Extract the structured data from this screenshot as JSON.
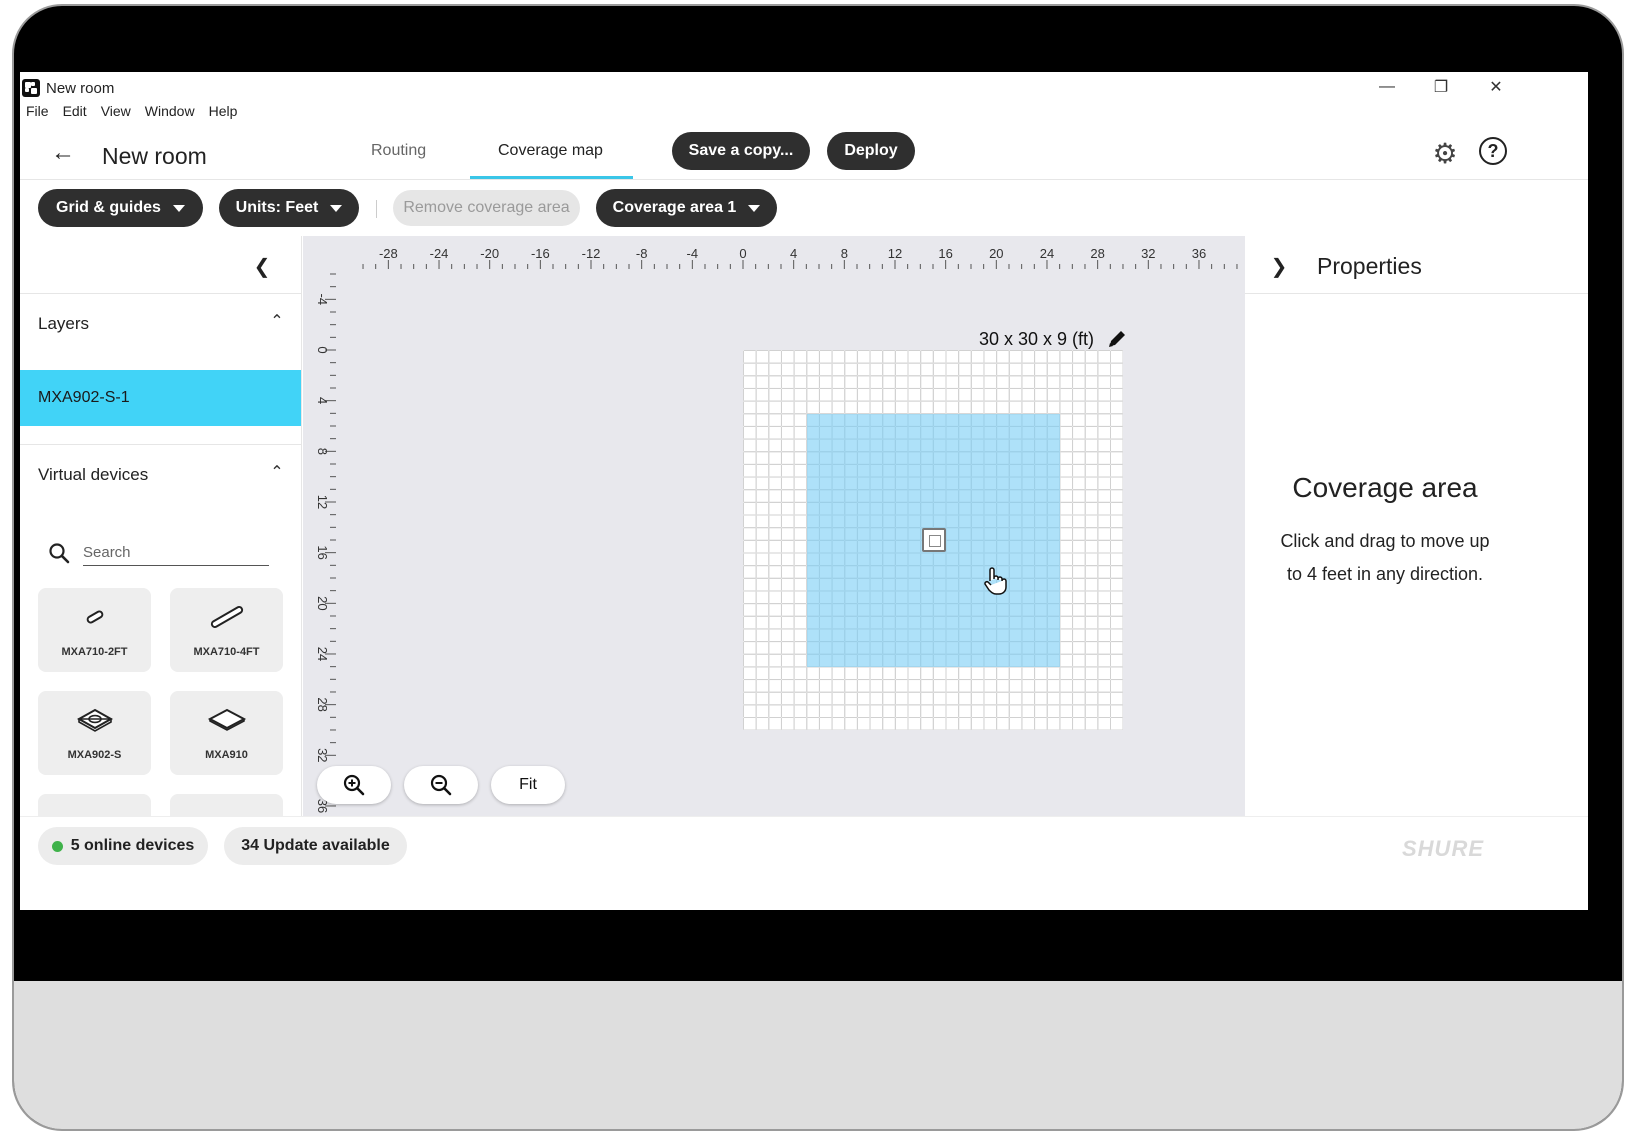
{
  "window": {
    "title": "New room"
  },
  "menu": [
    "File",
    "Edit",
    "View",
    "Window",
    "Help"
  ],
  "header": {
    "page_title": "New room",
    "tabs": [
      {
        "label": "Routing",
        "active": false
      },
      {
        "label": "Coverage map",
        "active": true
      }
    ],
    "save_label": "Save a copy...",
    "deploy_label": "Deploy"
  },
  "toolbar": {
    "grid_label": "Grid & guides",
    "units_label": "Units: Feet",
    "remove_label": "Remove coverage area",
    "coverage_label": "Coverage area 1"
  },
  "left_panel": {
    "layers_title": "Layers",
    "layer_item": "MXA902-S-1",
    "virtual_title": "Virtual devices",
    "search_placeholder": "Search",
    "devices": [
      {
        "label": "MXA710-2FT",
        "icon": "bar-mic-short-icon"
      },
      {
        "label": "MXA710-4FT",
        "icon": "bar-mic-long-icon"
      },
      {
        "label": "MXA902-S",
        "icon": "ceiling-speaker-icon"
      },
      {
        "label": "MXA910",
        "icon": "ceiling-array-icon"
      }
    ]
  },
  "canvas": {
    "room_dimensions": "30 x 30 x 9 (ft)",
    "ruler_x": [
      "-28",
      "-24",
      "-20",
      "-16",
      "-12",
      "-8",
      "-4",
      "0",
      "4",
      "8",
      "12",
      "16",
      "20",
      "24",
      "28",
      "32",
      "36"
    ],
    "ruler_y": [
      "-4",
      "0",
      "4",
      "8",
      "12",
      "16",
      "20",
      "24",
      "28",
      "32",
      "36"
    ],
    "fit_label": "Fit"
  },
  "properties": {
    "title": "Properties",
    "heading": "Coverage area",
    "description": "Click and drag to move up to 4 feet in any direction."
  },
  "footer": {
    "online_label": "5 online devices",
    "update_label": "34 Update available",
    "brand": "SHURE"
  },
  "colors": {
    "accent": "#41d3f7",
    "coverage_fill": "#78cdf5",
    "dark_button": "#2f2f2f",
    "online_status": "#3fb24a"
  }
}
